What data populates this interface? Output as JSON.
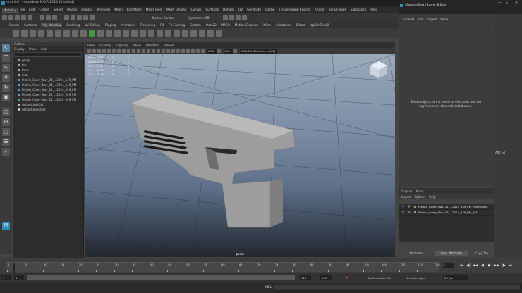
{
  "window": {
    "title": "untitled* - Autodesk MAYA 2025 (Untitled)",
    "controls": [
      "—",
      "☐",
      "✕"
    ]
  },
  "menubar": {
    "mode": "Modeling",
    "items": [
      "File",
      "Edit",
      "Create",
      "Select",
      "Modify",
      "Display",
      "Windows",
      "Mesh",
      "Edit Mesh",
      "Mesh Tools",
      "Mesh Display",
      "Curves",
      "Surfaces",
      "Deform",
      "UV",
      "Generate",
      "Cache",
      "Tissue Graph Engine",
      "Arnold",
      "Bonus Tools",
      "Substance",
      "Help"
    ]
  },
  "statusline": {
    "surface_field": "No Live Surface",
    "symmetry": "Symmetry: Off"
  },
  "shelf": {
    "tabs": [
      "Curves",
      "Surfaces",
      "Poly Modeling",
      "Sculpting",
      "UV Editing",
      "Rigging",
      "Animation",
      "Rendering",
      "FX",
      "FX Caching",
      "Custom",
      "Octo22",
      "MASH",
      "Motion Graphics",
      "XGen",
      "Substance",
      "Bifrost",
      "ngSkinTools2"
    ],
    "active_tab": "Poly Modeling"
  },
  "outliner": {
    "title": "Outliner",
    "menu": [
      "Display",
      "Show",
      "Help"
    ],
    "items": [
      {
        "label": "persp",
        "kind": "camera"
      },
      {
        "label": "top",
        "kind": "camera"
      },
      {
        "label": "front",
        "kind": "camera"
      },
      {
        "label": "side",
        "kind": "camera"
      },
      {
        "label": "Pistolo_Corey_Nov_24_...2024_649_PM",
        "kind": "mesh"
      },
      {
        "label": "Pistolo_Corey_Nov_24_...2024_649_PM",
        "kind": "mesh"
      },
      {
        "label": "Pistolo_Corey_Nov_24_...2024_649_PM",
        "kind": "mesh"
      },
      {
        "label": "Pistolo_Corey_Nov_24_...2024_649_PM",
        "kind": "mesh"
      },
      {
        "label": "Pistolo_Corey_Nov_24_...2024_649_PM",
        "kind": "mesh"
      },
      {
        "label": "defaultLightSet",
        "kind": "set"
      },
      {
        "label": "defaultObjectSet",
        "kind": "set"
      }
    ]
  },
  "viewport": {
    "menu": [
      "View",
      "Shading",
      "Lighting",
      "Show",
      "Renderer",
      "Panels"
    ],
    "camera_value": "0.00",
    "scale_value": "1.00",
    "color_space": "ACES 1.0 SDR-video (sRGB)",
    "camera_label": "persp",
    "hud": {
      "rows": [
        {
          "label": "Verts:",
          "v1": "2384",
          "v2": "0",
          "v3": "0"
        },
        {
          "label": "Edges:",
          "v1": "6072",
          "v2": "0",
          "v3": "0"
        },
        {
          "label": "Faces:",
          "v1": "3186",
          "v2": "0",
          "v3": "0"
        },
        {
          "label": "Tris:",
          "v1": "4642",
          "v2": "0",
          "v3": "0"
        },
        {
          "label": "UVs:",
          "v1": "2999",
          "v2": "0",
          "v3": "0"
        }
      ]
    }
  },
  "channel_box": {
    "title": "Channel Box / Layer Editor",
    "menu": [
      "Channels",
      "Edit",
      "Object",
      "Show"
    ],
    "empty_message": "Select objects in the scene to view, edit and set keyframes on channels (attributes).",
    "layer_tabs": [
      "Display",
      "Anim"
    ],
    "layer_menu": [
      "Layers",
      "Options",
      "Help"
    ],
    "layers": [
      {
        "v": "V",
        "p": "P",
        "name": "Pistolo_Corey_Nov_24_...2024_649_PM_ReflImages"
      },
      {
        "v": "V",
        "p": "P",
        "name": "Pistolo_Corey_Nov_24_...2024_649_PM_Ref1"
      }
    ],
    "buttons": {
      "left": "Attributes",
      "middle": "Load Attributes",
      "right": "Copy Tab"
    }
  },
  "sidebar": {
    "label": "Attr Ed"
  },
  "timeline": {
    "ticks": [
      "1",
      "5",
      "10",
      "15",
      "20",
      "25",
      "30",
      "35",
      "40",
      "45",
      "50",
      "55",
      "60",
      "65",
      "70",
      "75",
      "80",
      "85",
      "90",
      "95",
      "100",
      "105",
      "110",
      "115",
      "120"
    ],
    "current_frame": "1",
    "playback": [
      "⏮",
      "◀|",
      "◀◀",
      "◀",
      "▶",
      "▶▶",
      "|▶",
      "⏭"
    ]
  },
  "range": {
    "start": "1",
    "inner_start": "1",
    "inner_end": "120",
    "end": "120",
    "end2": "200",
    "character_set": "No Character Set",
    "anim_layer": "No Anim Layer",
    "fps": "24 fps"
  },
  "command_line": {
    "label": "MEL"
  },
  "colors": {
    "accent": "#2a8fb8",
    "viewport_top": "#9aa9ba",
    "viewport_bottom": "#23272f"
  }
}
